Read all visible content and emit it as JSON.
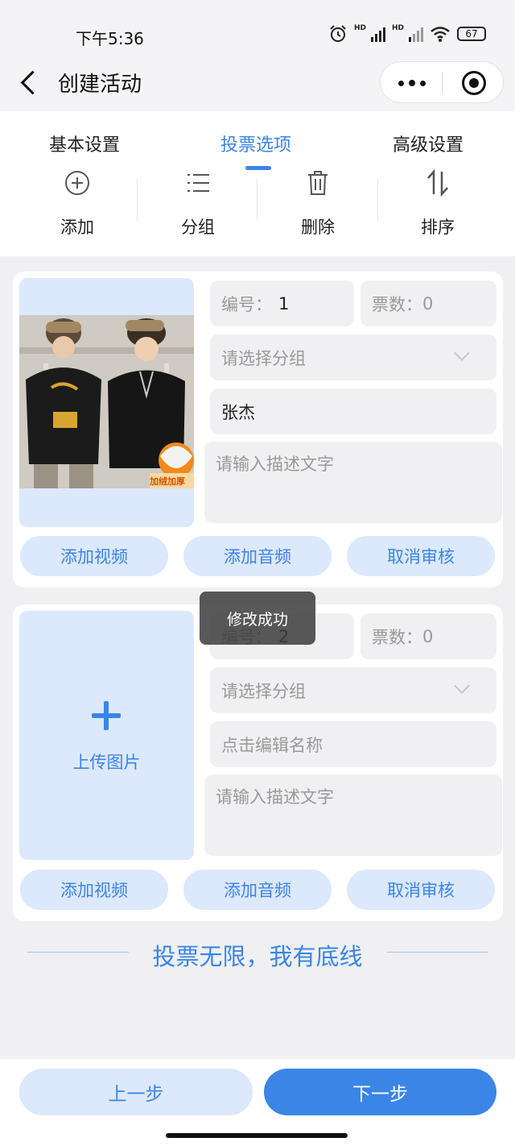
{
  "status": {
    "time": "下午5:36",
    "battery": "67",
    "hd1": "HD",
    "hd2": "HD"
  },
  "nav": {
    "title": "创建活动"
  },
  "tabs": [
    {
      "label": "基本设置",
      "active": false
    },
    {
      "label": "投票选项",
      "active": true
    },
    {
      "label": "高级设置",
      "active": false
    }
  ],
  "toolbar": {
    "add": "添加",
    "group": "分组",
    "delete": "删除",
    "sort": "排序"
  },
  "items": [
    {
      "number_label": "编号：",
      "number": "1",
      "votes_label": "票数：",
      "votes": "0",
      "group_placeholder": "请选择分组",
      "name": "张杰",
      "desc_placeholder": "请输入描述文字",
      "add_video": "添加视频",
      "add_audio": "添加音频",
      "cancel_review": "取消审核",
      "image_badge": "加绒加厚"
    },
    {
      "number_label": "编号：",
      "number": "2",
      "votes_label": "票数：",
      "votes": "0",
      "group_placeholder": "请选择分组",
      "name_placeholder": "点击编辑名称",
      "desc_placeholder": "请输入描述文字",
      "upload_label": "上传图片",
      "add_video": "添加视频",
      "add_audio": "添加音频",
      "cancel_review": "取消审核"
    }
  ],
  "toast": "修改成功",
  "slogan": "投票无限，我有底线",
  "footer": {
    "prev": "上一步",
    "next": "下一步"
  },
  "colors": {
    "accent": "#3a85e6",
    "accent_light": "#dce8fb",
    "field_bg": "#f0f0f2"
  }
}
